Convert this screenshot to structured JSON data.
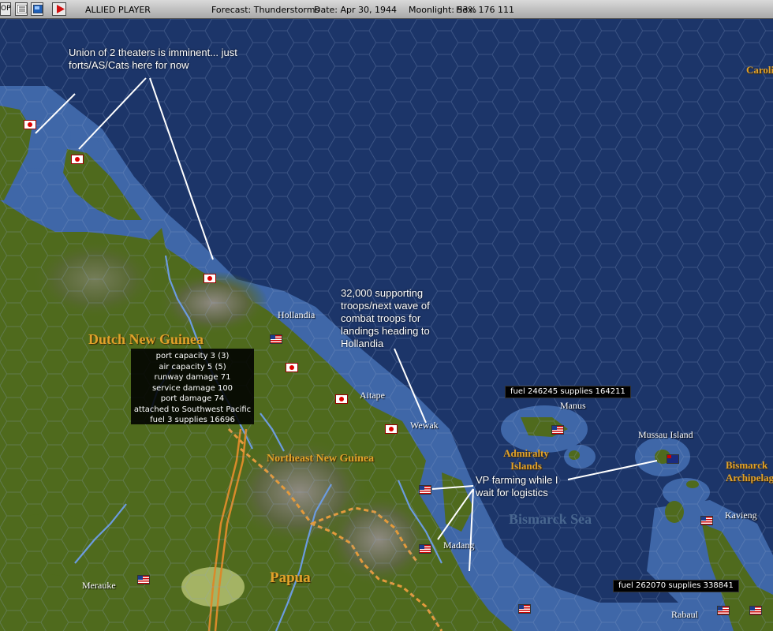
{
  "toolbar": {
    "button_op_label": "OP",
    "mode_title": "ALLIED PLAYER",
    "forecast": "Forecast: Thunderstorms",
    "date": "Date: Apr 30, 1944",
    "moonlight": "Moonlight: 53%",
    "hex": "Hex: 176 111"
  },
  "annotations": {
    "union_note": "Union of 2 theaters is imminent... just forts/AS/Cats here for now",
    "support_note": "32,000 supporting troops/next wave of combat troops for landings heading to Hollandia",
    "vp_note": "VP farming while I wait for logistics"
  },
  "regions": {
    "dutch_new_guinea": "Dutch New Guinea",
    "northeast_new_guinea": "Northeast New Guinea",
    "papua": "Papua",
    "admiralty": "Admiralty Islands",
    "bismarck_arch": "Bismarck Archipelago",
    "bismarck_sea": "Bismarck Sea",
    "caroline": "Caroline"
  },
  "places": {
    "hollandia": "Hollandia",
    "aitape": "Aitape",
    "wewak": "Wewak",
    "madang": "Madang",
    "merauke": "Merauke",
    "manus": "Manus",
    "mussau": "Mussau Island",
    "kavieng": "Kavieng",
    "rabaul": "Rabaul"
  },
  "base_tooltip": {
    "lines": [
      "port capacity 3 (3)",
      "air capacity 5 (5)",
      "runway damage 71",
      "service damage 100",
      "port damage 74",
      "attached to Southwest Pacific",
      "fuel 3  supplies 16696"
    ]
  },
  "manus_info": "fuel 246245  supplies 164211",
  "rabaul_info": "fuel 262070  supplies 338841",
  "colors": {
    "ocean_deep": "#1c3569",
    "ocean_shallow": "#3f67a8",
    "land": "#4f6a1d",
    "region_label": "#e1a22a"
  }
}
